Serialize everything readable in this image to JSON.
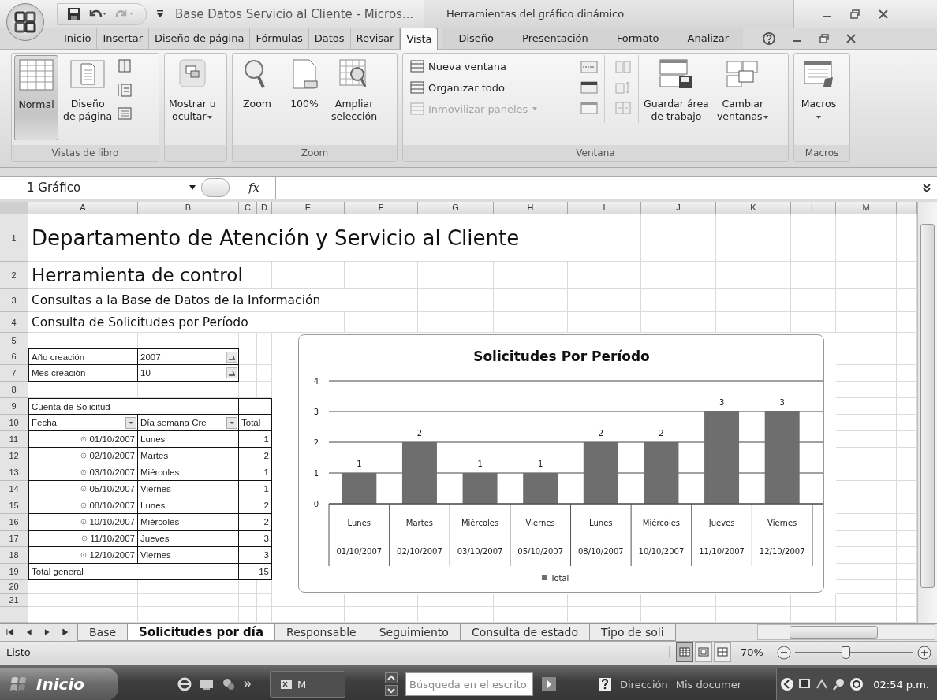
{
  "title_bar": {
    "title": "Base Datos Servicio al Cliente - Micros...",
    "context_title": "Herramientas del gráfico dinámico"
  },
  "ribbon_tabs": [
    {
      "label": "Inicio",
      "selected": false,
      "kind": "main"
    },
    {
      "label": "Insertar",
      "selected": false,
      "kind": "main"
    },
    {
      "label": "Diseño de página",
      "selected": false,
      "kind": "main"
    },
    {
      "label": "Fórmulas",
      "selected": false,
      "kind": "main"
    },
    {
      "label": "Datos",
      "selected": false,
      "kind": "main"
    },
    {
      "label": "Revisar",
      "selected": false,
      "kind": "main"
    },
    {
      "label": "Vista",
      "selected": true,
      "kind": "main"
    },
    {
      "label": "Diseño",
      "selected": false,
      "kind": "context"
    },
    {
      "label": "Presentación",
      "selected": false,
      "kind": "context"
    },
    {
      "label": "Formato",
      "selected": false,
      "kind": "context"
    },
    {
      "label": "Analizar",
      "selected": false,
      "kind": "context"
    }
  ],
  "ribbon": {
    "views": {
      "label": "Vistas de libro",
      "normal": {
        "label": "Normal",
        "selected": true
      },
      "page_layout": {
        "label": "Diseño\nde página",
        "selected": false
      }
    },
    "show_hide": {
      "label": "Mostrar u\nocultar"
    },
    "zoom": {
      "label": "Zoom",
      "buttons": [
        "Zoom",
        "100%",
        "Ampliar\nselección"
      ]
    },
    "window": {
      "label": "Ventana",
      "commands": [
        {
          "label": "Nueva ventana",
          "disabled": false
        },
        {
          "label": "Organizar todo",
          "disabled": false
        },
        {
          "label": "Inmovilizar paneles",
          "disabled": true
        }
      ],
      "save_workspace": "Guardar área\nde trabajo",
      "switch_windows": "Cambiar\nventanas"
    },
    "macros": {
      "label": "Macros",
      "button": "Macros"
    }
  },
  "formula_bar": {
    "name_box": "1 Gráfico",
    "function_label": "fx"
  },
  "sheet": {
    "columns": [
      "A",
      "B",
      "C",
      "D",
      "E",
      "F",
      "G",
      "H",
      "I",
      "J",
      "K",
      "L",
      "M"
    ],
    "row_numbers": [
      "1",
      "2",
      "3",
      "4",
      "5",
      "6",
      "7",
      "8",
      "9",
      "10",
      "11",
      "12",
      "13",
      "14",
      "15",
      "16",
      "17",
      "18",
      "19",
      "20",
      "21"
    ],
    "titles": [
      "Departamento de Atención y Servicio al Cliente",
      "Herramienta de control",
      "Consultas a la Base de Datos de la Información",
      "Consulta de Solicitudes por Período"
    ],
    "filters": [
      {
        "label": "Año creación",
        "value": "2007"
      },
      {
        "label": "Mes creación",
        "value": "10"
      }
    ],
    "pivot": {
      "caption": "Cuenta de Solicitud",
      "headers": [
        "Fecha",
        "Día semana Cre",
        "Total"
      ],
      "rows": [
        {
          "date": "01/10/2007",
          "day": "Lunes",
          "total": "1"
        },
        {
          "date": "02/10/2007",
          "day": "Martes",
          "total": "2"
        },
        {
          "date": "03/10/2007",
          "day": "Miércoles",
          "total": "1"
        },
        {
          "date": "05/10/2007",
          "day": "Viernes",
          "total": "1"
        },
        {
          "date": "08/10/2007",
          "day": "Lunes",
          "total": "2"
        },
        {
          "date": "10/10/2007",
          "day": "Miércoles",
          "total": "2"
        },
        {
          "date": "11/10/2007",
          "day": "Jueves",
          "total": "3"
        },
        {
          "date": "12/10/2007",
          "day": "Viernes",
          "total": "3"
        }
      ],
      "grand_total": {
        "label": "Total general",
        "value": "15"
      }
    }
  },
  "chart": {
    "chart_data": {
      "type": "bar",
      "title": "Solicitudes Por Período",
      "categories": [
        [
          "Lunes",
          "01/10/2007"
        ],
        [
          "Martes",
          "02/10/2007"
        ],
        [
          "Miércoles",
          "03/10/2007"
        ],
        [
          "Viernes",
          "05/10/2007"
        ],
        [
          "Lunes",
          "08/10/2007"
        ],
        [
          "Miércoles",
          "10/10/2007"
        ],
        [
          "Jueves",
          "11/10/2007"
        ],
        [
          "Viernes",
          "12/10/2007"
        ]
      ],
      "series": [
        {
          "name": "Total",
          "color": "#6e6e6e",
          "values": [
            1,
            2,
            1,
            1,
            2,
            2,
            3,
            3
          ]
        }
      ],
      "ylim": [
        0,
        4
      ],
      "yticks": [
        0,
        1,
        2,
        3,
        4
      ],
      "grid": true,
      "data_labels": true
    }
  },
  "sheet_tabs": [
    {
      "label": "Base",
      "selected": false
    },
    {
      "label": "Solicitudes por día",
      "selected": true
    },
    {
      "label": "Responsable",
      "selected": false
    },
    {
      "label": "Seguimiento",
      "selected": false
    },
    {
      "label": "Consulta de estado",
      "selected": false
    },
    {
      "label": "Tipo de soli",
      "selected": false
    }
  ],
  "status_bar": {
    "status": "Listo",
    "views": [
      {
        "selected": true
      },
      {
        "selected": false
      },
      {
        "selected": false
      }
    ],
    "zoom": "70%",
    "zoom_level": {
      "level": 0.42
    }
  },
  "taskbar": {
    "start": "Inicio",
    "task": "M",
    "search_placeholder": "Búsqueda en el escrito",
    "toolbars": [
      "Dirección",
      "Mis documer"
    ],
    "clock": "02:54 p.m."
  }
}
